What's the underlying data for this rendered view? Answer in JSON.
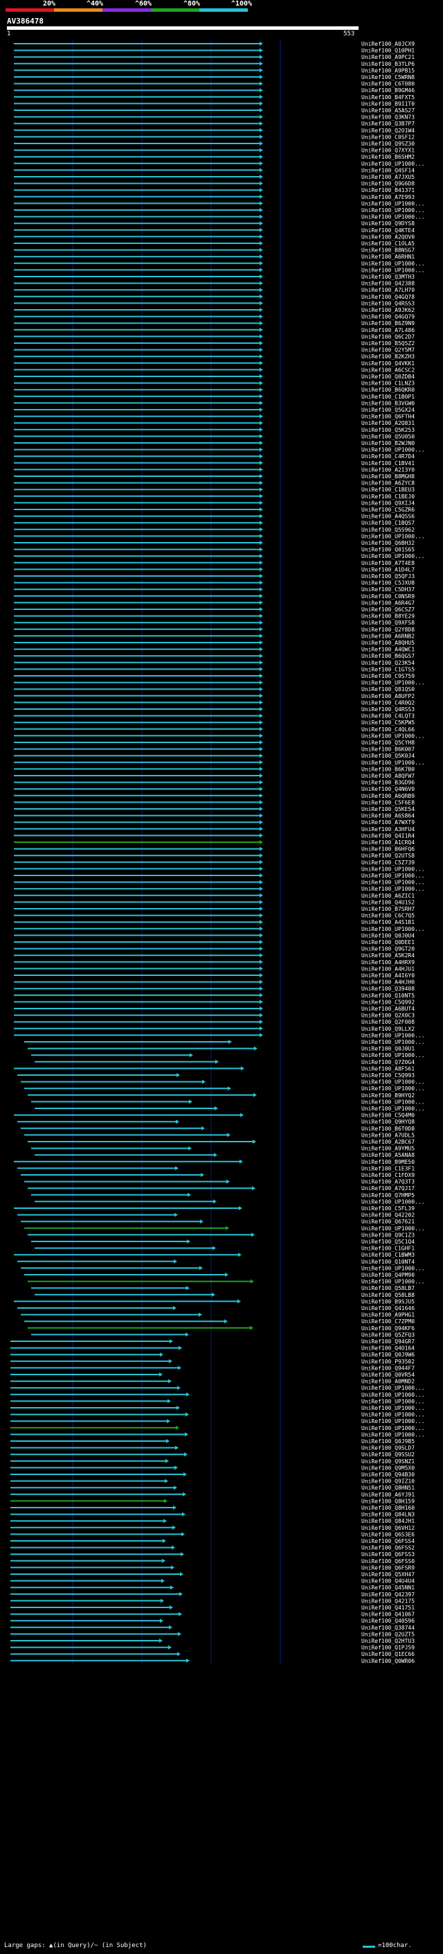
{
  "query": {
    "id": "AV386478",
    "start": "1",
    "end": "553"
  },
  "legend": {
    "labels": [
      "20%",
      "^40%",
      "^60%",
      "^80%",
      "^100%"
    ],
    "colors": [
      "#e0141e",
      "#e88a1a",
      "#8a2be2",
      "#1fa51f",
      "#27c3d6"
    ]
  },
  "footer": {
    "gaps_text": "Large gaps: ▲(in Query)/~ (in Subject)",
    "scale_text": "=100char."
  },
  "chart_data": {
    "type": "alignment-overview",
    "x_range": [
      1,
      553
    ],
    "ids": [
      "UniRef100_A0JCX9",
      "UniRef100_Q10PH1",
      "UniRef100_A9PC21",
      "UniRef100_B3TLP6",
      "UniRef100_A9PB15",
      "UniRef100_C5WRN8",
      "UniRef100_C6T080",
      "UniRef100_B9GM46",
      "UniRef100_B4FXT5",
      "UniRef100_B9I1T0",
      "UniRef100_A5AS27",
      "UniRef100_Q3KN73",
      "UniRef100_Q3B7P7",
      "UniRef100_Q2O1W4",
      "UniRef100_C0SF12",
      "UniRef100_Q9SZ30",
      "UniRef100_Q7XYX1",
      "UniRef100_B6SHM2",
      "UniRef100_UP1000...",
      "UniRef100_Q4SF14",
      "UniRef100_A7JXU5",
      "UniRef100_Q9G6D8",
      "UniRef100_B41371",
      "UniRef100_A7E993",
      "UniRef100_UP1000...",
      "UniRef100_UP1000...",
      "UniRef100_UP1000...",
      "UniRef100_Q9DYS8",
      "UniRef100_Q4KTE4",
      "UniRef100_A2QOV0",
      "UniRef100_C1OLA5",
      "UniRef100_B8NSG7",
      "UniRef100_A6RHN1",
      "UniRef100_UP1000...",
      "UniRef100_UP1000...",
      "UniRef100_Q3MTH3",
      "UniRef100_Q42388",
      "UniRef100_A7LH70",
      "UniRef100_Q4GQ78",
      "UniRef100_Q4RSS3",
      "UniRef100_A9JK62",
      "UniRef100_Q4GQ79",
      "UniRef100_B6Z9N9",
      "UniRef100_A7L486",
      "UniRef100_Q6C2D7",
      "UniRef100_B5Q5Z2",
      "UniRef100_Q2Y5M7",
      "UniRef100_B2KZH3",
      "UniRef100_Q4VKK1",
      "UniRef100_A6CSC2",
      "UniRef100_Q0ZDB4",
      "UniRef100_C1LNZ3",
      "UniRef100_B6QKR0",
      "UniRef100_C1B0P1",
      "UniRef100_B3VGW0",
      "UniRef100_Q5GX24",
      "UniRef100_Q6FTH4",
      "UniRef100_A2Q831",
      "UniRef100_Q5K253",
      "UniRef100_Q5U050",
      "UniRef100_B2WJN0",
      "UniRef100_UP1000...",
      "UniRef100_C4R7D4",
      "UniRef100_C1BV41",
      "UniRef100_A2I3Y0",
      "UniRef100_B8MGH8",
      "UniRef100_A6ZYC8",
      "UniRef100_C1BEU3",
      "UniRef100_C1BEJ0",
      "UniRef100_Q9XIJ4",
      "UniRef100_C5GZR6",
      "UniRef100_A4QSS6",
      "UniRef100_C1BQS7",
      "UniRef100_Q5S962",
      "UniRef100_UP1000...",
      "UniRef100_Q6BH32",
      "UniRef100_Q01S65",
      "UniRef100_UP1000...",
      "UniRef100_A7T4E8",
      "UniRef100_A1D4L7",
      "UniRef100_Q5QFJ3",
      "UniRef100_C5JXU8",
      "UniRef100_C5DH37",
      "UniRef100_C0NSR9",
      "UniRef100_A6R4G7",
      "UniRef100_Q6CSZ7",
      "UniRef100_B8YE29",
      "UniRef100_Q9XFS8",
      "UniRef100_Q2Y8D8",
      "UniRef100_A6RNB2",
      "UniRef100_A8QHU5",
      "UniRef100_A4QWC1",
      "UniRef100_B6QGS7",
      "UniRef100_Q23K54",
      "UniRef100_C1GTS5",
      "UniRef100_C9S759",
      "UniRef100_UP1000...",
      "UniRef100_Q81QS0",
      "UniRef100_A8UFP2",
      "UniRef100_C4R0Q2",
      "UniRef100_Q4RSS3",
      "UniRef100_C4LQT3",
      "UniRef100_C5KPW5",
      "UniRef100_C4QL66",
      "UniRef100_UP1000...",
      "UniRef100_Q5CYH8",
      "UniRef100_B6K007",
      "UniRef100_Q5K0J4",
      "UniRef100_UP1000...",
      "UniRef100_B6K7B0",
      "UniRef100_A8QFW7",
      "UniRef100_B3GD96",
      "UniRef100_Q4N6V0",
      "UniRef100_A6QRB9",
      "UniRef100_C5F6E8",
      "UniRef100_Q5KE54",
      "UniRef100_A6S864",
      "UniRef100_A7WXT9",
      "UniRef100_A3HFU4",
      "UniRef100_Q4I1R4",
      "UniRef100_A1CRQ4",
      "UniRef100_B6HFQ6",
      "UniRef100_Q2UTS8",
      "UniRef100_C5Z739",
      "UniRef100_UP1000...",
      "UniRef100_UP1000...",
      "UniRef100_UP1000...",
      "UniRef100_UP1000...",
      "UniRef100_A6ZIC1",
      "UniRef100_Q4U1S2",
      "UniRef100_B7SRH7",
      "UniRef100_C6C7Q5",
      "UniRef100_A4S1B1",
      "UniRef100_UP1000...",
      "UniRef100_Q0J0U4",
      "UniRef100_Q0DEE1",
      "UniRef100_Q9GT20",
      "UniRef100_A5K2R4",
      "UniRef100_A4HRX9",
      "UniRef100_A4HJU1",
      "UniRef100_A4I6Y0",
      "UniRef100_A4HJH0",
      "UniRef100_Q39408",
      "UniRef100_Q10NT5",
      "UniRef100_C5Q992",
      "UniRef100_A6BUT4",
      "UniRef100_Q2X0C3",
      "UniRef100_Q2F008",
      "UniRef100_Q9LLX2",
      "UniRef100_UP1000...",
      "UniRef100_UP1000...",
      "UniRef100_Q0J0U1",
      "UniRef100_UP1000...",
      "UniRef100_Q7Z0G4",
      "UniRef100_A8F561",
      "UniRef100_C5Q993",
      "UniRef100_UP1000...",
      "UniRef100_UP1000...",
      "UniRef100_B9HYQ2",
      "UniRef100_UP1000...",
      "UniRef100_UP1000...",
      "UniRef100_C5Q4M0",
      "UniRef100_Q9HYQ8",
      "UniRef100_B6T0D8",
      "UniRef100_A7UDL5",
      "UniRef100_A2BC67",
      "UniRef100_A9YMU5",
      "UniRef100_A5ANA8",
      "UniRef100_B9ME50",
      "UniRef100_C1E3F1",
      "UniRef100_C1FDX9",
      "UniRef100_A7Q3T3",
      "UniRef100_A7QJ17",
      "UniRef100_Q7HMP5",
      "UniRef100_UP1000...",
      "UniRef100_C5FL39",
      "UniRef100_Q42202",
      "UniRef100_Q67621",
      "UniRef100_UP1000...",
      "UniRef100_Q9C1Z3",
      "UniRef100_Q5C1Q4",
      "UniRef100_C1GHF1",
      "UniRef100_C1BWM3",
      "UniRef100_Q10NT4",
      "UniRef100_UP1000...",
      "UniRef100_Q4PM90",
      "UniRef100_UP1000...",
      "UniRef100_Q58LB7",
      "UniRef100_Q58LB8",
      "UniRef100_B9SJU5",
      "UniRef100_Q41646",
      "UniRef100_A9PHG1",
      "UniRef100_C7ZPM0",
      "UniRef100_Q94KF6",
      "UniRef100_Q5ZFQ3",
      "UniRef100_Q94GR7",
      "UniRef100_Q4O164",
      "UniRef100_Q0J9W6",
      "UniRef100_P93502",
      "UniRef100_Q944F7",
      "UniRef100_Q0VR54",
      "UniRef100_A0MND2",
      "UniRef100_UP1000...",
      "UniRef100_UP1000...",
      "UniRef100_UP1000...",
      "UniRef100_UP1000...",
      "UniRef100_UP1000...",
      "UniRef100_UP1000...",
      "UniRef100_UP1000...",
      "UniRef100_UP1000...",
      "UniRef100_Q0J9B5",
      "UniRef100_Q9SLD7",
      "UniRef100_Q9SSU2",
      "UniRef100_Q9SNZ1",
      "UniRef100_Q9M5X0",
      "UniRef100_Q94B30",
      "UniRef100_Q9IZ10",
      "UniRef100_Q8HN51",
      "UniRef100_A6YJ91",
      "UniRef100_Q8H159",
      "UniRef100_Q8H160",
      "UniRef100_Q84LN3",
      "UniRef100_Q84JH1",
      "UniRef100_Q6VH12",
      "UniRef100_Q6S3E6",
      "UniRef100_Q6FSS4",
      "UniRef100_Q6FSS2",
      "UniRef100_Q6FSS3",
      "UniRef100_Q6FSS0",
      "UniRef100_Q6FSR9",
      "UniRef100_Q5XH47",
      "UniRef100_Q4U4U4",
      "UniRef100_Q45NN1",
      "UniRef100_Q42397",
      "UniRef100_Q42175",
      "UniRef100_Q41751",
      "UniRef100_Q41067",
      "UniRef100_Q40596",
      "UniRef100_Q38744",
      "UniRef100_Q2UZT5",
      "UniRef100_Q2HTU3",
      "UniRef100_Q1PJ59",
      "UniRef100_Q1EC66",
      "UniRef100_Q0WR06"
    ]
  }
}
